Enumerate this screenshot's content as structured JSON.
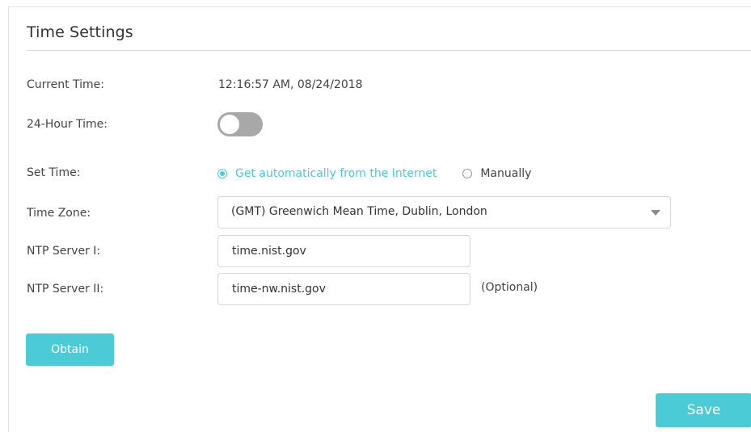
{
  "page": {
    "title": "Time Settings"
  },
  "fields": {
    "current_time": {
      "label": "Current Time:",
      "value": "12:16:57 AM, 08/24/2018"
    },
    "hour24": {
      "label": "24-Hour Time:",
      "enabled": false
    },
    "set_time": {
      "label": "Set Time:",
      "options": [
        {
          "label": "Get automatically from the Internet",
          "selected": true
        },
        {
          "label": "Manually",
          "selected": false
        }
      ]
    },
    "time_zone": {
      "label": "Time Zone:",
      "value": "(GMT) Greenwich Mean Time, Dublin, London"
    },
    "ntp1": {
      "label": "NTP Server I:",
      "value": "time.nist.gov"
    },
    "ntp2": {
      "label": "NTP Server II:",
      "value": "time-nw.nist.gov",
      "hint": "(Optional)"
    }
  },
  "buttons": {
    "obtain": "Obtain",
    "save": "Save"
  },
  "colors": {
    "accent": "#4acbd6",
    "toggle_off": "#a8a8a8",
    "text": "#444444"
  },
  "icons": {
    "dropdown": "caret-down-icon"
  }
}
